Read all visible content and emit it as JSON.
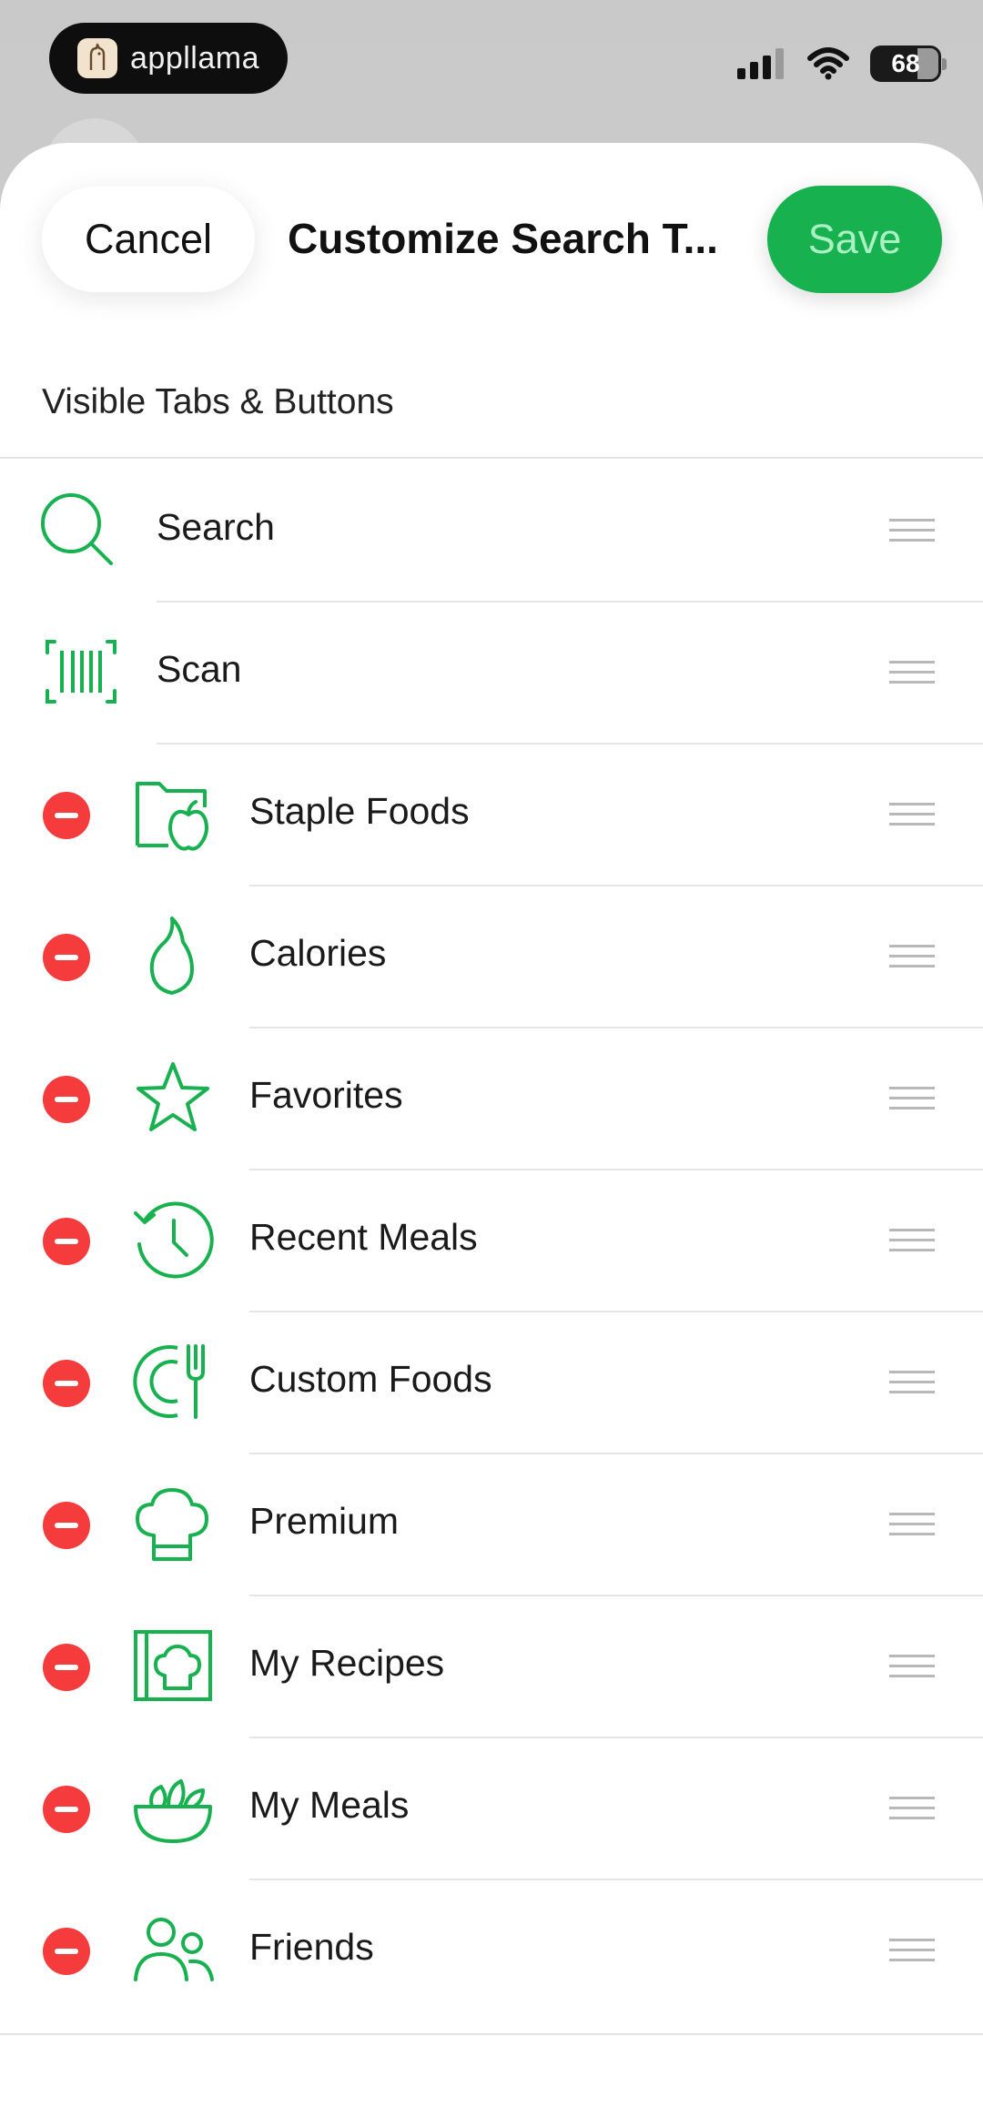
{
  "status_bar": {
    "brand": "appllama",
    "battery": "68"
  },
  "header": {
    "cancel_label": "Cancel",
    "title": "Customize Search T...",
    "save_label": "Save"
  },
  "section": {
    "title": "Visible Tabs & Buttons"
  },
  "items": [
    {
      "label": "Search",
      "icon": "search-icon",
      "removable": false
    },
    {
      "label": "Scan",
      "icon": "barcode-scan-icon",
      "removable": false
    },
    {
      "label": "Staple Foods",
      "icon": "folder-apple-icon",
      "removable": true
    },
    {
      "label": "Calories",
      "icon": "flame-icon",
      "removable": true
    },
    {
      "label": "Favorites",
      "icon": "star-icon",
      "removable": true
    },
    {
      "label": "Recent Meals",
      "icon": "history-clock-icon",
      "removable": true
    },
    {
      "label": "Custom Foods",
      "icon": "plate-fork-icon",
      "removable": true
    },
    {
      "label": "Premium",
      "icon": "chef-hat-icon",
      "removable": true
    },
    {
      "label": "My Recipes",
      "icon": "recipe-book-icon",
      "removable": true
    },
    {
      "label": "My Meals",
      "icon": "salad-bowl-icon",
      "removable": true
    },
    {
      "label": "Friends",
      "icon": "friends-icon",
      "removable": true
    }
  ],
  "colors": {
    "accent_green": "#17b150",
    "remove_red": "#f53b3b"
  }
}
